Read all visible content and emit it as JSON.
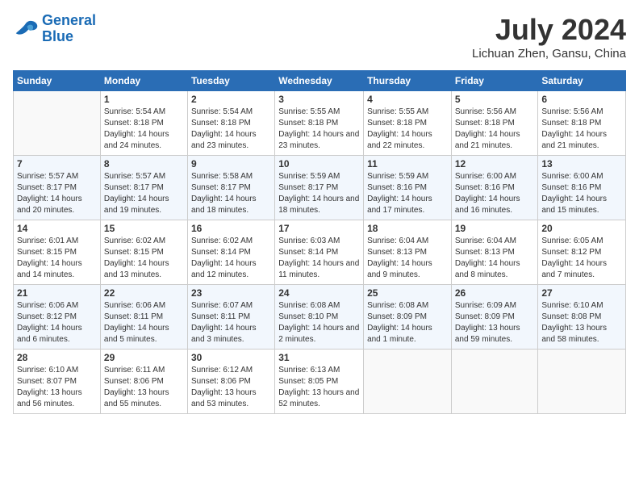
{
  "logo": {
    "line1": "General",
    "line2": "Blue"
  },
  "title": "July 2024",
  "location": "Lichuan Zhen, Gansu, China",
  "days_of_week": [
    "Sunday",
    "Monday",
    "Tuesday",
    "Wednesday",
    "Thursday",
    "Friday",
    "Saturday"
  ],
  "weeks": [
    [
      {
        "day": "",
        "info": ""
      },
      {
        "day": "1",
        "info": "Sunrise: 5:54 AM\nSunset: 8:18 PM\nDaylight: 14 hours and 24 minutes."
      },
      {
        "day": "2",
        "info": "Sunrise: 5:54 AM\nSunset: 8:18 PM\nDaylight: 14 hours and 23 minutes."
      },
      {
        "day": "3",
        "info": "Sunrise: 5:55 AM\nSunset: 8:18 PM\nDaylight: 14 hours and 23 minutes."
      },
      {
        "day": "4",
        "info": "Sunrise: 5:55 AM\nSunset: 8:18 PM\nDaylight: 14 hours and 22 minutes."
      },
      {
        "day": "5",
        "info": "Sunrise: 5:56 AM\nSunset: 8:18 PM\nDaylight: 14 hours and 21 minutes."
      },
      {
        "day": "6",
        "info": "Sunrise: 5:56 AM\nSunset: 8:18 PM\nDaylight: 14 hours and 21 minutes."
      }
    ],
    [
      {
        "day": "7",
        "info": "Sunrise: 5:57 AM\nSunset: 8:17 PM\nDaylight: 14 hours and 20 minutes."
      },
      {
        "day": "8",
        "info": "Sunrise: 5:57 AM\nSunset: 8:17 PM\nDaylight: 14 hours and 19 minutes."
      },
      {
        "day": "9",
        "info": "Sunrise: 5:58 AM\nSunset: 8:17 PM\nDaylight: 14 hours and 18 minutes."
      },
      {
        "day": "10",
        "info": "Sunrise: 5:59 AM\nSunset: 8:17 PM\nDaylight: 14 hours and 18 minutes."
      },
      {
        "day": "11",
        "info": "Sunrise: 5:59 AM\nSunset: 8:16 PM\nDaylight: 14 hours and 17 minutes."
      },
      {
        "day": "12",
        "info": "Sunrise: 6:00 AM\nSunset: 8:16 PM\nDaylight: 14 hours and 16 minutes."
      },
      {
        "day": "13",
        "info": "Sunrise: 6:00 AM\nSunset: 8:16 PM\nDaylight: 14 hours and 15 minutes."
      }
    ],
    [
      {
        "day": "14",
        "info": "Sunrise: 6:01 AM\nSunset: 8:15 PM\nDaylight: 14 hours and 14 minutes."
      },
      {
        "day": "15",
        "info": "Sunrise: 6:02 AM\nSunset: 8:15 PM\nDaylight: 14 hours and 13 minutes."
      },
      {
        "day": "16",
        "info": "Sunrise: 6:02 AM\nSunset: 8:14 PM\nDaylight: 14 hours and 12 minutes."
      },
      {
        "day": "17",
        "info": "Sunrise: 6:03 AM\nSunset: 8:14 PM\nDaylight: 14 hours and 11 minutes."
      },
      {
        "day": "18",
        "info": "Sunrise: 6:04 AM\nSunset: 8:13 PM\nDaylight: 14 hours and 9 minutes."
      },
      {
        "day": "19",
        "info": "Sunrise: 6:04 AM\nSunset: 8:13 PM\nDaylight: 14 hours and 8 minutes."
      },
      {
        "day": "20",
        "info": "Sunrise: 6:05 AM\nSunset: 8:12 PM\nDaylight: 14 hours and 7 minutes."
      }
    ],
    [
      {
        "day": "21",
        "info": "Sunrise: 6:06 AM\nSunset: 8:12 PM\nDaylight: 14 hours and 6 minutes."
      },
      {
        "day": "22",
        "info": "Sunrise: 6:06 AM\nSunset: 8:11 PM\nDaylight: 14 hours and 5 minutes."
      },
      {
        "day": "23",
        "info": "Sunrise: 6:07 AM\nSunset: 8:11 PM\nDaylight: 14 hours and 3 minutes."
      },
      {
        "day": "24",
        "info": "Sunrise: 6:08 AM\nSunset: 8:10 PM\nDaylight: 14 hours and 2 minutes."
      },
      {
        "day": "25",
        "info": "Sunrise: 6:08 AM\nSunset: 8:09 PM\nDaylight: 14 hours and 1 minute."
      },
      {
        "day": "26",
        "info": "Sunrise: 6:09 AM\nSunset: 8:09 PM\nDaylight: 13 hours and 59 minutes."
      },
      {
        "day": "27",
        "info": "Sunrise: 6:10 AM\nSunset: 8:08 PM\nDaylight: 13 hours and 58 minutes."
      }
    ],
    [
      {
        "day": "28",
        "info": "Sunrise: 6:10 AM\nSunset: 8:07 PM\nDaylight: 13 hours and 56 minutes."
      },
      {
        "day": "29",
        "info": "Sunrise: 6:11 AM\nSunset: 8:06 PM\nDaylight: 13 hours and 55 minutes."
      },
      {
        "day": "30",
        "info": "Sunrise: 6:12 AM\nSunset: 8:06 PM\nDaylight: 13 hours and 53 minutes."
      },
      {
        "day": "31",
        "info": "Sunrise: 6:13 AM\nSunset: 8:05 PM\nDaylight: 13 hours and 52 minutes."
      },
      {
        "day": "",
        "info": ""
      },
      {
        "day": "",
        "info": ""
      },
      {
        "day": "",
        "info": ""
      }
    ]
  ]
}
